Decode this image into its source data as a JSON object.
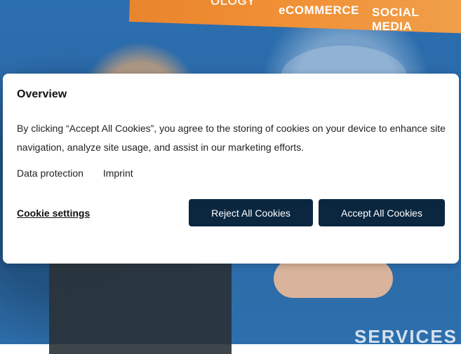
{
  "background": {
    "banner_items": [
      "OLOGY",
      "eCOMMERCE",
      "SOCIAL MEDIA"
    ],
    "bottom_text": "SERVICES"
  },
  "cookie_dialog": {
    "title": "Overview",
    "description": "By clicking “Accept All Cookies”, you agree to the storing of cookies on your device to enhance site navigation, analyze site usage, and assist in our marketing efforts.",
    "links": [
      "Data protection",
      "Imprint"
    ],
    "settings_label": "Cookie settings",
    "reject_label": "Reject All Cookies",
    "accept_label": "Accept All Cookies",
    "colors": {
      "button_bg": "#0b2740",
      "button_text": "#ffffff"
    }
  }
}
